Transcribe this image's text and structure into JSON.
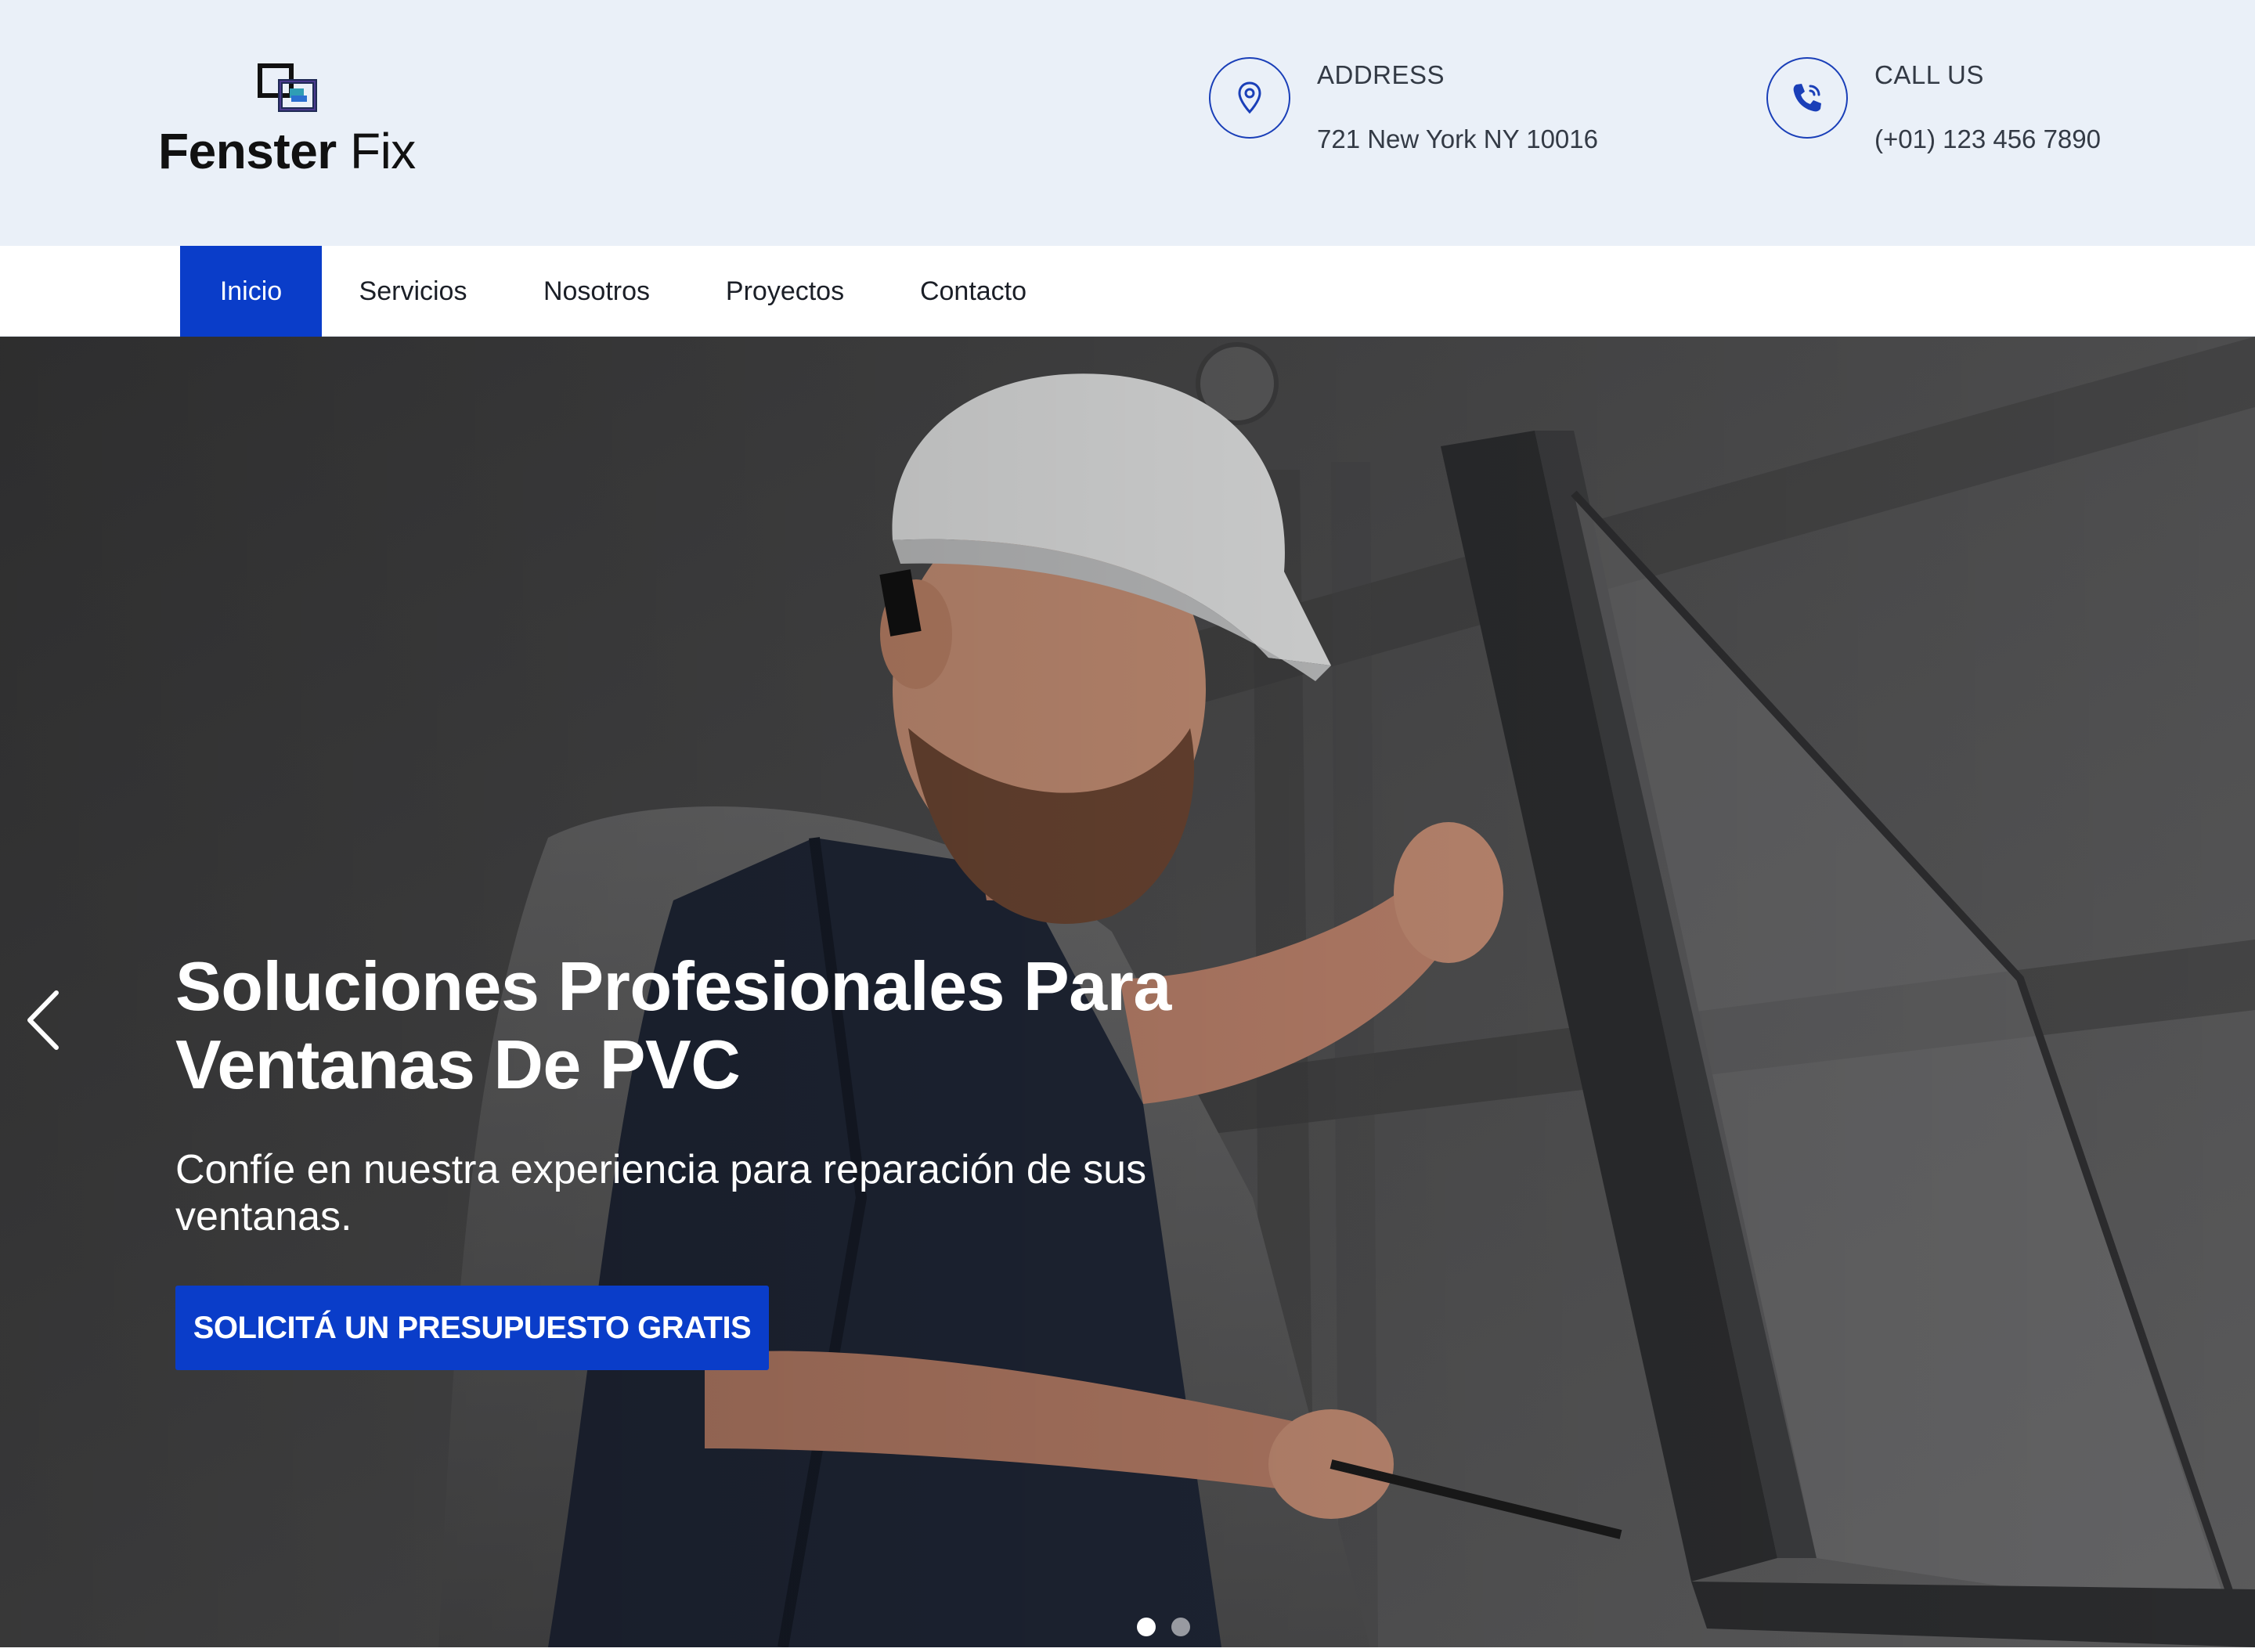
{
  "brand": {
    "name_bold": "Fenster",
    "name_light": "Fix",
    "logo_icon": "window-frames-logo-icon"
  },
  "contact": {
    "address": {
      "label": "ADDRESS",
      "value": "721 New York NY 10016",
      "icon": "map-pin-icon"
    },
    "call": {
      "label": "CALL US",
      "value": "(+01) 123 456 7890",
      "icon": "phone-icon"
    }
  },
  "nav": {
    "items": [
      {
        "label": "Inicio",
        "active": true
      },
      {
        "label": "Servicios",
        "active": false
      },
      {
        "label": "Nosotros",
        "active": false
      },
      {
        "label": "Proyectos",
        "active": false
      },
      {
        "label": "Contacto",
        "active": false
      }
    ]
  },
  "hero": {
    "title_line1": "Soluciones Profesionales Para",
    "title_line2": "Ventanas De PVC",
    "subtitle": "Confíe en nuestra experiencia para reparación de sus ventanas.",
    "cta_label": "SOLICITÁ UN PRESUPUESTO GRATIS",
    "slide_count": 2,
    "active_slide": 1
  },
  "colors": {
    "accent": "#0a3dc9",
    "topbar_bg": "#eaf0f8",
    "text_dark": "#1b1f27"
  }
}
